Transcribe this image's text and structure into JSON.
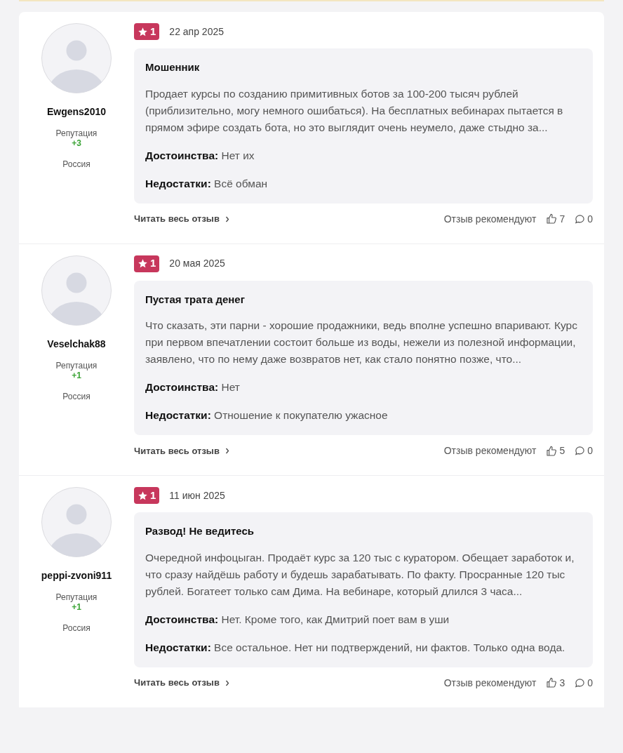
{
  "reviews": [
    {
      "author": "Ewgens2010",
      "reputation_label": "Репутация",
      "reputation": "+3",
      "country": "Россия",
      "rating": "1",
      "date": "22 апр 2025",
      "title": "Мошенник",
      "text": "Продает курсы по созданию примитивных ботов за 100-200 тысяч рублей (приблизительно, могу немного ошибаться). На бесплатных вебинарах пытается в прямом эфире создать бота, но это выглядит очень неумело, даже стыдно за...",
      "pros_label": "Достоинства:",
      "pros": "Нет их",
      "cons_label": "Недостатки:",
      "cons": "Всё обман",
      "read_more": "Читать весь отзыв",
      "recommend_label": "Отзыв рекомендуют",
      "likes": "7",
      "comments": "0"
    },
    {
      "author": "Veselchak88",
      "reputation_label": "Репутация",
      "reputation": "+1",
      "country": "Россия",
      "rating": "1",
      "date": "20 мая 2025",
      "title": "Пустая трата денег",
      "text": "Что сказать, эти парни - хорошие продажники, ведь вполне успешно впаривают. Курс при первом впечатлении состоит больше из воды, нежели из полезной информации, заявлено, что по нему даже возвратов нет, как стало понятно позже, что...",
      "pros_label": "Достоинства:",
      "pros": "Нет",
      "cons_label": "Недостатки:",
      "cons": "Отношение к покупателю ужасное",
      "read_more": "Читать весь отзыв",
      "recommend_label": "Отзыв рекомендуют",
      "likes": "5",
      "comments": "0"
    },
    {
      "author": "peppi-zvoni911",
      "reputation_label": "Репутация",
      "reputation": "+1",
      "country": "Россия",
      "rating": "1",
      "date": "11 июн 2025",
      "title": "Развод! Не ведитесь",
      "text": "Очередной инфоцыган. Продаёт курс за 120 тыс с куратором. Обещает заработок и, что сразу найдёшь работу и будешь зарабатывать. По факту. Просранные 120 тыс рублей. Богатеет только сам Дима. На вебинаре, который длился 3 часа...",
      "pros_label": "Достоинства:",
      "pros": "Нет. Кроме того, как Дмитрий поет вам в уши",
      "cons_label": "Недостатки:",
      "cons": "Все остальное. Нет ни подтверждений, ни фактов. Только одна вода.",
      "read_more": "Читать весь отзыв",
      "recommend_label": "Отзыв рекомендуют",
      "likes": "3",
      "comments": "0"
    }
  ]
}
